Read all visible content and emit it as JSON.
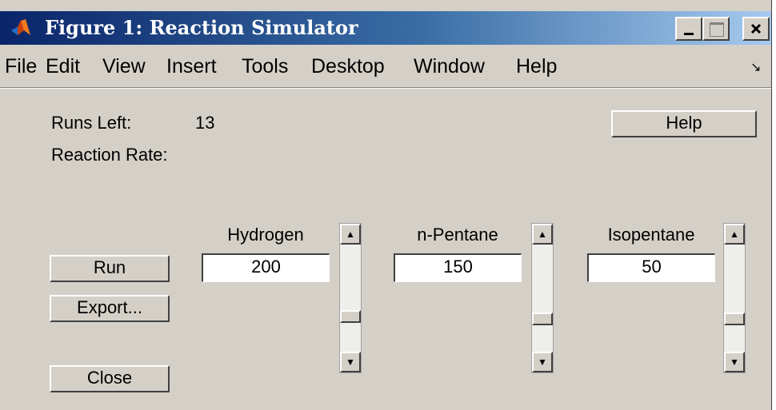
{
  "window": {
    "title": "Figure 1: Reaction Simulator"
  },
  "titlebar_buttons": {
    "minimize": "_",
    "maximize": "□",
    "close": "×"
  },
  "menu": [
    "File",
    "Edit",
    "View",
    "Insert",
    "Tools",
    "Desktop",
    "Window",
    "Help"
  ],
  "menu_arrow": "↘",
  "status": {
    "runs_left_label": "Runs Left:",
    "runs_left_value": "13",
    "reaction_rate_label": "Reaction Rate:"
  },
  "buttons": {
    "help": "Help",
    "run": "Run",
    "export": "Export...",
    "close": "Close"
  },
  "inputs": [
    {
      "label": "Hydrogen",
      "value": "200",
      "slider_level": 0.42
    },
    {
      "label": "n-Pentane",
      "value": "150",
      "slider_level": 0.45
    },
    {
      "label": "Isopentane",
      "value": "50",
      "slider_level": 0.45
    }
  ],
  "colors": {
    "titlebar_start": "#0a246a",
    "titlebar_end": "#a6caf0",
    "panel": "#d4d0c8"
  },
  "icons": {
    "app": "matlab-logo-icon",
    "scroll_up": "arrow-up-icon",
    "scroll_down": "arrow-down-icon"
  },
  "arrow_glyphs": {
    "up": "▲",
    "down": "▼"
  }
}
